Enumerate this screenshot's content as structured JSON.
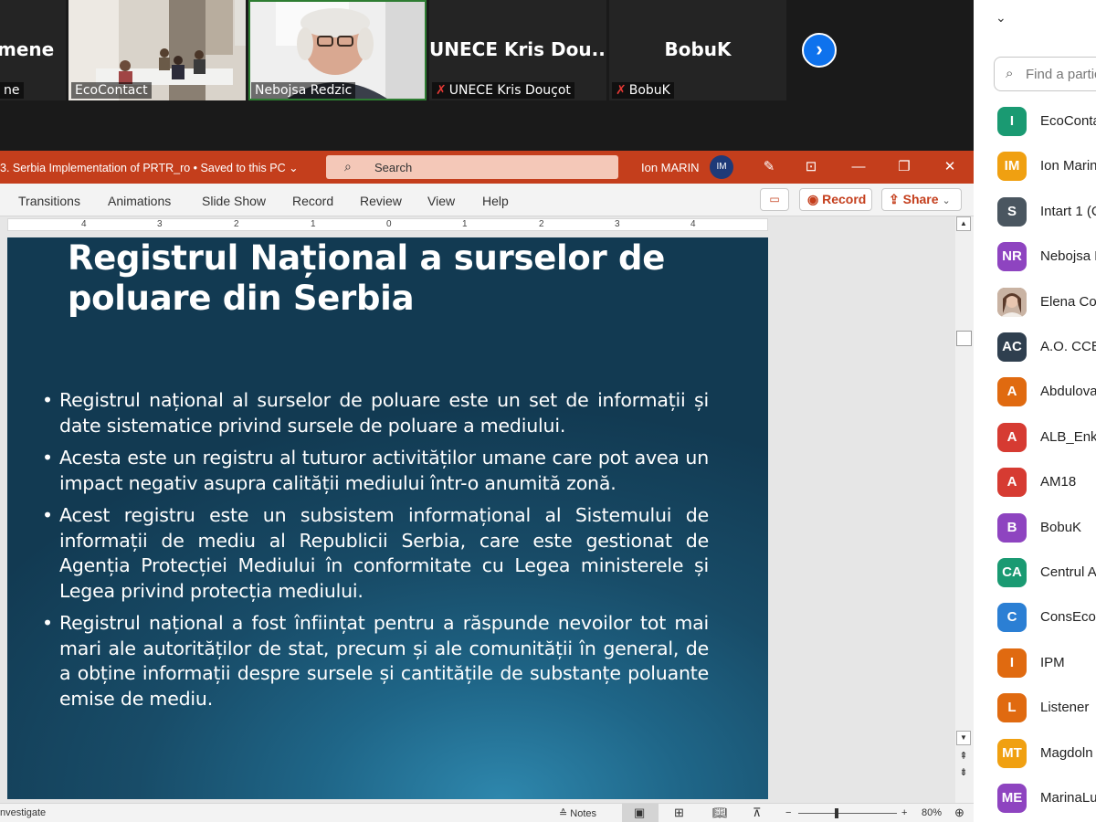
{
  "video": {
    "tiles": [
      {
        "big": "mene",
        "label": "ne",
        "muted": false
      },
      {
        "big": "",
        "label": "EcoContact",
        "muted": false
      },
      {
        "big": "",
        "label": "Nebojsa Redzic",
        "muted": false
      },
      {
        "big": "UNECE Kris Dou...",
        "label": "UNECE Kris Douçot",
        "muted": true
      },
      {
        "big": "BobuK",
        "label": "BobuK",
        "muted": true
      }
    ],
    "next_icon": "chevron-right-icon"
  },
  "ppt": {
    "doc_title": "3. Serbia Implementation of PRTR_ro • Saved to this PC ⌄",
    "search_placeholder": "Search",
    "user_name": "Ion MARIN",
    "user_initials": "IM",
    "accent_color": "#c43e1c",
    "tabs": [
      "Transitions",
      "Animations",
      "Slide Show",
      "Record",
      "Review",
      "View",
      "Help"
    ],
    "record_label": "Record",
    "share_label": "Share",
    "ruler_numbers": [
      "4",
      "3",
      "2",
      "1",
      "0",
      "1",
      "2",
      "3",
      "4"
    ],
    "slide": {
      "title": "Registrul Național a surselor de poluare din Serbia",
      "bullets": [
        "Registrul național al surselor de poluare este un set de informații și date sistematice privind sursele de poluare a mediului.",
        "Acesta este un registru al tuturor activităților umane care pot avea un impact negativ asupra calității mediului într-o anumită zonă.",
        "Acest registru este un subsistem informațional al Sistemului de informații de mediu al Republicii Serbia, care este gestionat de Agenția Protecției Mediului în conformitate cu Legea ministerele și Legea privind protecția mediului.",
        "Registrul național a fost înființat pentru a răspunde nevoilor tot mai mari ale autorităților de stat, precum și ale comunității în general, de a obține informații despre sursele și cantitățile de substanțe poluante emise de mediu."
      ]
    },
    "status": {
      "left_text": "nvestigate",
      "notes_label": "Notes",
      "zoom": "80%"
    }
  },
  "participants": {
    "search_placeholder": "Find a partic",
    "list": [
      {
        "initials": "I",
        "name": "EcoConta",
        "color": "#1a9a72"
      },
      {
        "initials": "IM",
        "name": "Ion Marin",
        "color": "#f0a011"
      },
      {
        "initials": "S",
        "name": "Intart 1 (C",
        "color": "#4a5660"
      },
      {
        "initials": "NR",
        "name": "Nebojsa R",
        "color": "#8e44c0"
      },
      {
        "initials": "",
        "name": "Elena Coj",
        "color": "#b5896b",
        "photo": true
      },
      {
        "initials": "AC",
        "name": "A.O. CCE",
        "color": "#2f3f4f"
      },
      {
        "initials": "A",
        "name": "Abdulova",
        "color": "#e06a10"
      },
      {
        "initials": "A",
        "name": "ALB_Enke",
        "color": "#d63b32"
      },
      {
        "initials": "A",
        "name": "AM18",
        "color": "#d63b32"
      },
      {
        "initials": "B",
        "name": "BobuK",
        "color": "#8e44c0"
      },
      {
        "initials": "CA",
        "name": "Centrul A",
        "color": "#1a9a72"
      },
      {
        "initials": "C",
        "name": "ConsEco",
        "color": "#2b7fd4"
      },
      {
        "initials": "I",
        "name": "IPM",
        "color": "#e06a10"
      },
      {
        "initials": "L",
        "name": "Listener",
        "color": "#e06a10"
      },
      {
        "initials": "MT",
        "name": "Magdoln",
        "color": "#f0a011"
      },
      {
        "initials": "ME",
        "name": "MarinaLu",
        "color": "#8e44c0"
      }
    ]
  }
}
